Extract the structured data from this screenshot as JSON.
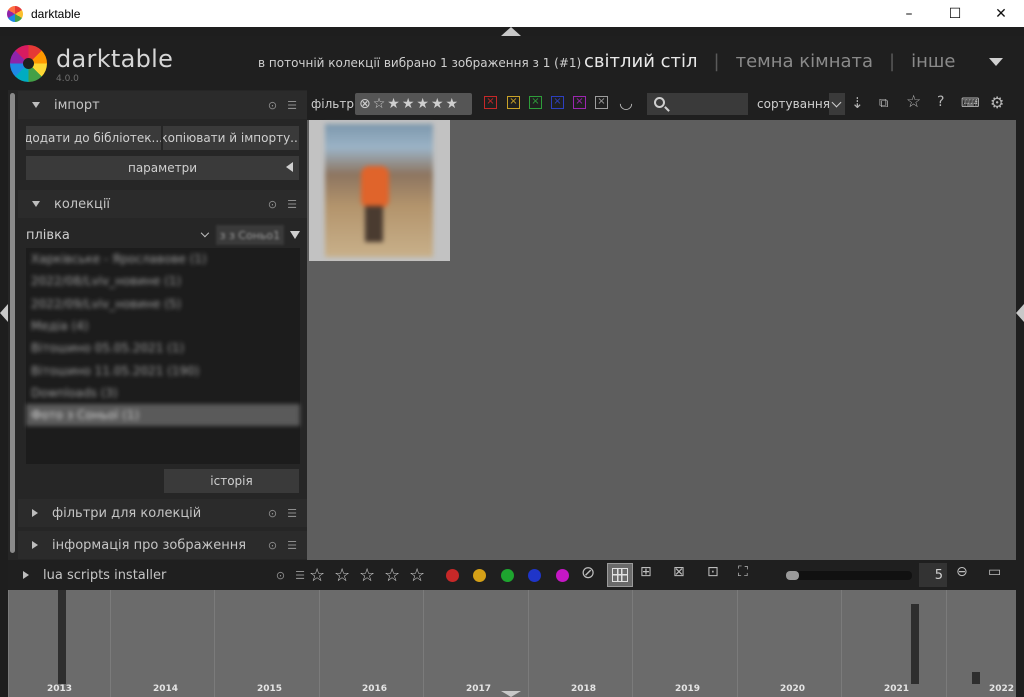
{
  "window": {
    "title": "darktable",
    "controls": [
      "–",
      "☐",
      "✕"
    ]
  },
  "header": {
    "logo_text": "darktable",
    "version": "4.0.0",
    "selection_info": "в поточній колекції вибрано 1 зображення з 1 (#1)",
    "views": [
      {
        "label": "світлий стіл",
        "active": true
      },
      {
        "label": "темна кімната",
        "active": false
      },
      {
        "label": "інше",
        "active": false
      }
    ],
    "view_separator": "|"
  },
  "left_panel": {
    "import": {
      "title": "імпорт",
      "add_to_library": "додати до бібліотек...",
      "copy_and_import": "копіювати й імпорту...",
      "parameters": "параметри"
    },
    "collections": {
      "title": "колекції",
      "property": "плівка",
      "value": "з з Соньо1",
      "items": [
        {
          "label": "Харківське - Ярославове (1)",
          "selected": false
        },
        {
          "label": "2022/08/Lviv_новине (1)",
          "selected": false
        },
        {
          "label": "2022/09/Lviv_новине (5)",
          "selected": false
        },
        {
          "label": "Медіа (4)",
          "selected": false
        },
        {
          "label": "Вітошино 05.05.2021 (1)",
          "selected": false
        },
        {
          "label": "Вітошино 11.05.2021 (190)",
          "selected": false
        },
        {
          "label": "Downloads (3)",
          "selected": false
        },
        {
          "label": "Фото з Соньої (1)",
          "selected": true
        }
      ],
      "history": "історія"
    },
    "collection_filters": {
      "title": "фільтри для колекцій"
    },
    "image_info": {
      "title": "інформація про зображення"
    },
    "lua": {
      "title": "lua scripts installer"
    }
  },
  "filter_bar": {
    "filter_label": "фільтр",
    "rating_filter_icons": [
      "⊗",
      "☆",
      "★",
      "★",
      "★",
      "★",
      "★"
    ],
    "color_labels": [
      {
        "name": "red",
        "color": "#c62828",
        "glyph": "×"
      },
      {
        "name": "yellow",
        "color": "#c9a227",
        "glyph": "×"
      },
      {
        "name": "green",
        "color": "#2e9d3a",
        "glyph": "×"
      },
      {
        "name": "blue",
        "color": "#2d3fbf",
        "glyph": "×"
      },
      {
        "name": "purple",
        "color": "#9c27b0",
        "glyph": "×"
      },
      {
        "name": "gray",
        "color": "#9e9e9e",
        "glyph": "×"
      }
    ],
    "and_or_icon": "◡",
    "search_placeholder": "",
    "sort_label": "сортування"
  },
  "bottom_bar": {
    "stars": [
      "☆",
      "☆",
      "☆",
      "☆",
      "☆"
    ],
    "color_dots": [
      "#c62828",
      "#d4a017",
      "#1ea52f",
      "#1f35c9",
      "#c517c5"
    ],
    "reject_icon": "⊘",
    "zoom_value": "5",
    "zoom_fraction": 0.1
  },
  "timeline": {
    "years": [
      "2013",
      "2014",
      "2015",
      "2016",
      "2017",
      "2018",
      "2019",
      "2020",
      "2021",
      "2022"
    ]
  },
  "colors": {
    "background": "#1e1e1e",
    "panel": "#262626",
    "center": "#5e5e5e",
    "timeline": "#6b6b6b",
    "accent_text": "#e8e8e8"
  }
}
